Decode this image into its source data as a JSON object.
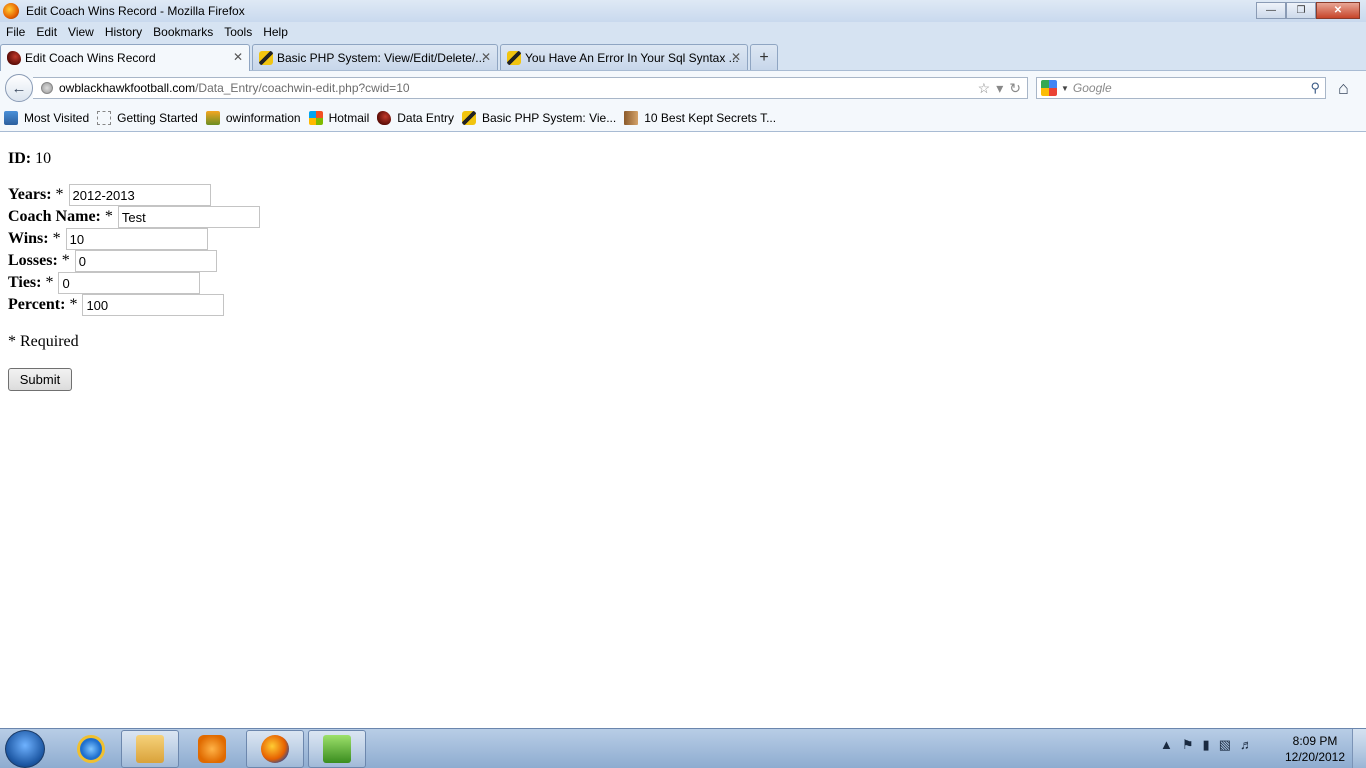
{
  "window": {
    "title": "Edit Coach Wins Record - Mozilla Firefox"
  },
  "menu": [
    "File",
    "Edit",
    "View",
    "History",
    "Bookmarks",
    "Tools",
    "Help"
  ],
  "tabs": [
    {
      "label": "Edit Coach Wins Record",
      "icon": "hawk-red-icon",
      "active": true
    },
    {
      "label": "Basic PHP System: View/Edit/Delete/...",
      "icon": "hawk-yellow-icon",
      "active": false
    },
    {
      "label": "You Have An Error In Your Sql Syntax ...",
      "icon": "hawk-yellow-icon",
      "active": false
    }
  ],
  "url": {
    "domain": "owblackhawkfootball.com",
    "path": "/Data_Entry/coachwin-edit.php?cwid=10"
  },
  "search": {
    "placeholder": "Google"
  },
  "bookmarks": [
    {
      "label": "Most Visited",
      "icon": "folder-icon"
    },
    {
      "label": "Getting Started",
      "icon": "page-icon"
    },
    {
      "label": "owinformation",
      "icon": "pma-icon"
    },
    {
      "label": "Hotmail",
      "icon": "hotmail-icon"
    },
    {
      "label": "Data Entry",
      "icon": "hawk-red-icon"
    },
    {
      "label": "Basic PHP System: Vie...",
      "icon": "hawk-yellow-icon"
    },
    {
      "label": "10 Best Kept Secrets T...",
      "icon": "book-icon"
    }
  ],
  "form": {
    "id_label": "ID:",
    "id_value": "10",
    "fields": {
      "years": {
        "label": "Years:",
        "value": "2012-2013"
      },
      "coach": {
        "label": "Coach Name:",
        "value": "Test"
      },
      "wins": {
        "label": "Wins:",
        "value": "10"
      },
      "losses": {
        "label": "Losses:",
        "value": "0"
      },
      "ties": {
        "label": "Ties:",
        "value": "0"
      },
      "percent": {
        "label": "Percent:",
        "value": "100"
      }
    },
    "required_mark": "*",
    "required_note": "* Required",
    "submit_label": "Submit"
  },
  "taskbar": {
    "clock_time": "8:09 PM",
    "clock_date": "12/20/2012"
  }
}
